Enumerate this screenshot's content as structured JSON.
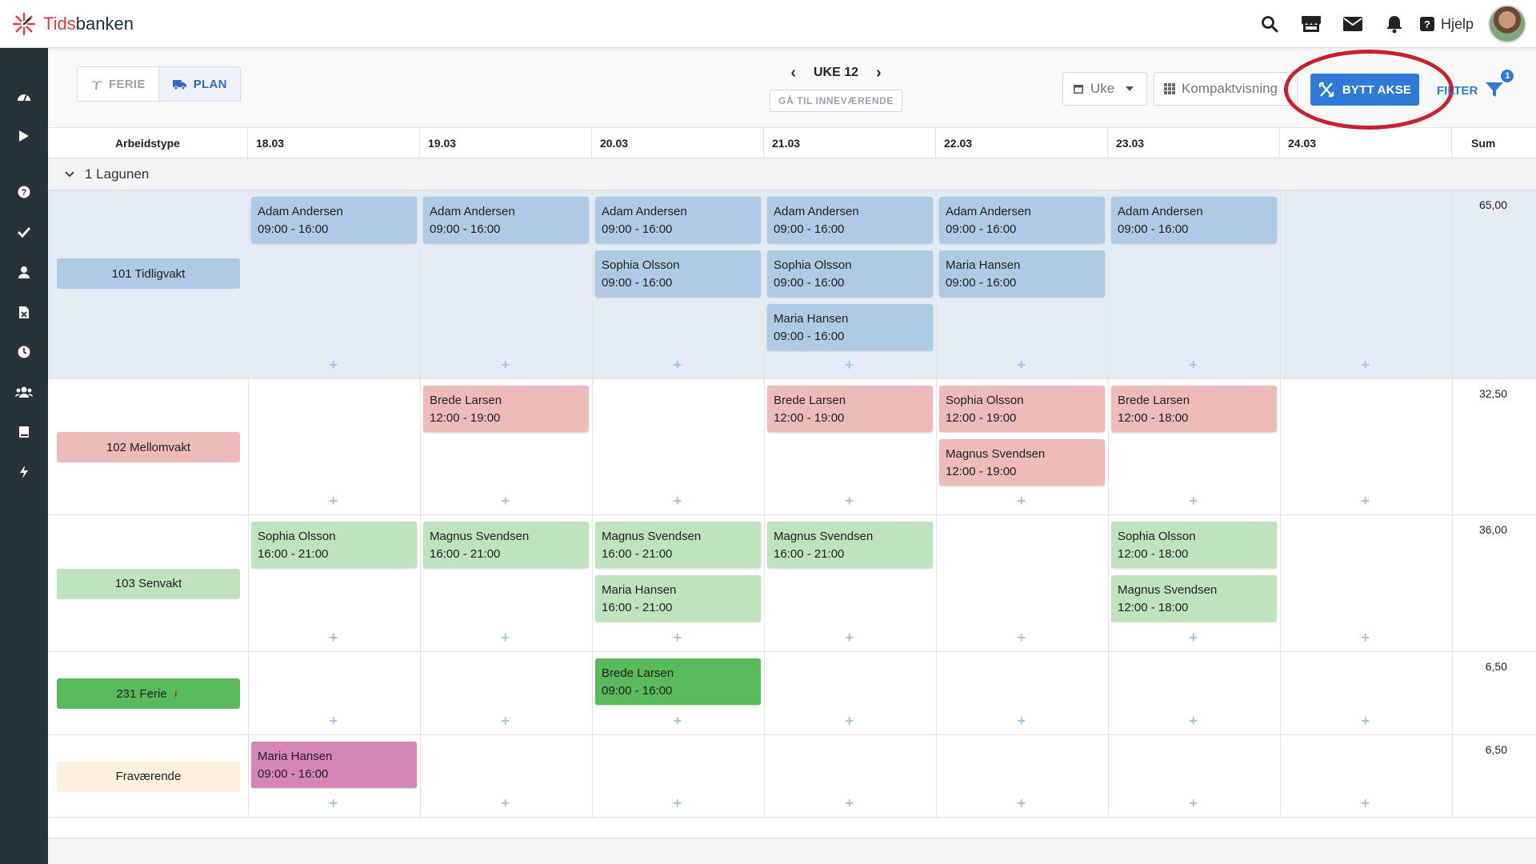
{
  "app": {
    "logo_prefix": "Tids",
    "logo_suffix": "banken",
    "help_label": "Hjelp"
  },
  "topbar_icons": [
    "search-icon",
    "store-icon",
    "mail-icon",
    "bell-icon",
    "help-icon"
  ],
  "sidebar_icons": [
    "dashboard-icon",
    "play-icon",
    "question-icon",
    "check-icon",
    "user-icon",
    "excel-file-icon",
    "clock-icon",
    "users-icon",
    "book-icon",
    "bolt-icon"
  ],
  "toolbar": {
    "ferie_label": "FERIE",
    "plan_label": "PLAN",
    "week_label": "UKE 12",
    "today_label": "GÅ TIL INNEVÆRENDE",
    "period_select": "Uke",
    "view_select": "Kompaktvisning",
    "swap_label": "BYTT AKSE",
    "filter_label": "FILTER",
    "filter_count": "1"
  },
  "colors": {
    "accent": "#2f7ad6",
    "tidligvakt": "#aecbe3",
    "mellomvakt": "#efbaba",
    "senvakt": "#bfe2bf",
    "ferie": "#59b95d",
    "fravaerende": "#d686b2",
    "highlight": "#c8202e"
  },
  "grid": {
    "type_header": "Arbeidstype",
    "days": [
      "18.03",
      "19.03",
      "20.03",
      "21.03",
      "22.03",
      "23.03",
      "24.03"
    ],
    "sum_header": "Sum",
    "group_label": "1 Lagunen",
    "rows": [
      {
        "label": "101 Tidligvakt",
        "sum": "65,00"
      },
      {
        "label": "102 Mellomvakt",
        "sum": "32,50"
      },
      {
        "label": "103 Senvakt",
        "sum": "36,00"
      },
      {
        "label": "231 Ferie",
        "sum": "6,50"
      },
      {
        "label": "Fraværende",
        "sum": "6,50"
      }
    ],
    "shifts": [
      {
        "row": 0,
        "day": 0,
        "name": "Adam Andersen",
        "time": "09:00 - 16:00"
      },
      {
        "row": 0,
        "day": 1,
        "name": "Adam Andersen",
        "time": "09:00 - 16:00"
      },
      {
        "row": 0,
        "day": 2,
        "name": "Adam Andersen",
        "time": "09:00 - 16:00"
      },
      {
        "row": 0,
        "day": 2,
        "name": "Sophia Olsson",
        "time": "09:00 - 16:00"
      },
      {
        "row": 0,
        "day": 3,
        "name": "Adam Andersen",
        "time": "09:00 - 16:00"
      },
      {
        "row": 0,
        "day": 3,
        "name": "Sophia Olsson",
        "time": "09:00 - 16:00"
      },
      {
        "row": 0,
        "day": 3,
        "name": "Maria Hansen",
        "time": "09:00 - 16:00"
      },
      {
        "row": 0,
        "day": 4,
        "name": "Adam Andersen",
        "time": "09:00 - 16:00"
      },
      {
        "row": 0,
        "day": 4,
        "name": "Maria Hansen",
        "time": "09:00 - 16:00"
      },
      {
        "row": 0,
        "day": 5,
        "name": "Adam Andersen",
        "time": "09:00 - 16:00"
      },
      {
        "row": 1,
        "day": 1,
        "name": "Brede Larsen",
        "time": "12:00 - 19:00"
      },
      {
        "row": 1,
        "day": 3,
        "name": "Brede Larsen",
        "time": "12:00 - 19:00"
      },
      {
        "row": 1,
        "day": 4,
        "name": "Sophia Olsson",
        "time": "12:00 - 19:00"
      },
      {
        "row": 1,
        "day": 4,
        "name": "Magnus Svendsen",
        "time": "12:00 - 19:00"
      },
      {
        "row": 1,
        "day": 5,
        "name": "Brede Larsen",
        "time": "12:00 - 18:00"
      },
      {
        "row": 2,
        "day": 0,
        "name": "Sophia Olsson",
        "time": "16:00 - 21:00"
      },
      {
        "row": 2,
        "day": 1,
        "name": "Magnus Svendsen",
        "time": "16:00 - 21:00"
      },
      {
        "row": 2,
        "day": 2,
        "name": "Magnus Svendsen",
        "time": "16:00 - 21:00"
      },
      {
        "row": 2,
        "day": 2,
        "name": "Maria Hansen",
        "time": "16:00 - 21:00"
      },
      {
        "row": 2,
        "day": 3,
        "name": "Magnus Svendsen",
        "time": "16:00 - 21:00"
      },
      {
        "row": 2,
        "day": 5,
        "name": "Sophia Olsson",
        "time": "12:00 - 18:00"
      },
      {
        "row": 2,
        "day": 5,
        "name": "Magnus Svendsen",
        "time": "12:00 - 18:00"
      },
      {
        "row": 3,
        "day": 2,
        "name": "Brede Larsen",
        "time": "09:00 - 16:00"
      },
      {
        "row": 4,
        "day": 0,
        "name": "Maria Hansen",
        "time": "09:00 - 16:00"
      }
    ]
  }
}
